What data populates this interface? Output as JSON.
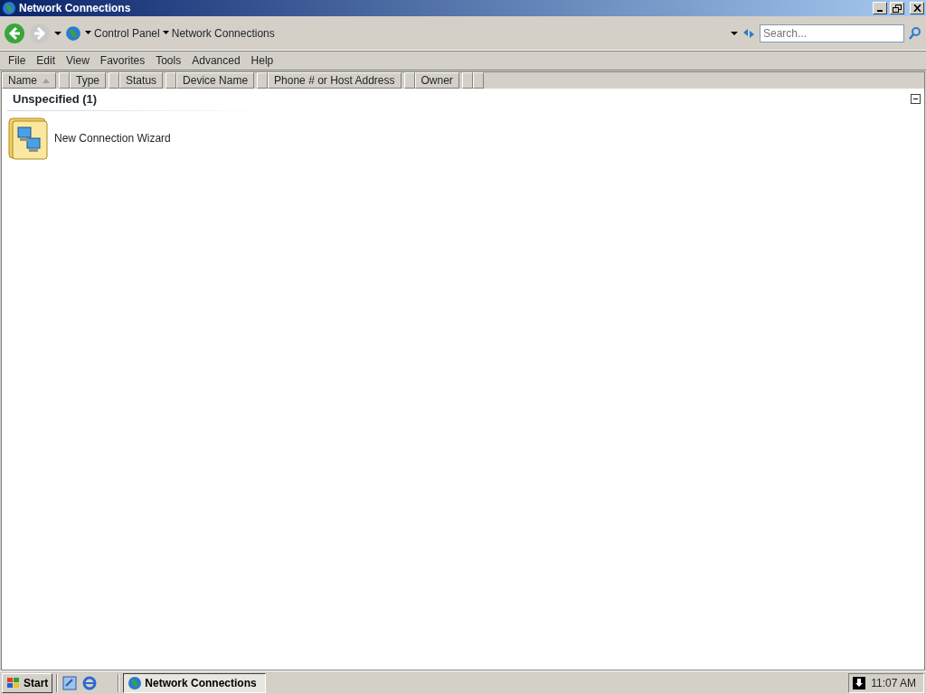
{
  "window": {
    "title": "Network Connections"
  },
  "address_bar": {
    "crumbs": [
      "Control Panel",
      "Network Connections"
    ]
  },
  "search": {
    "placeholder": "Search..."
  },
  "menu": [
    "File",
    "Edit",
    "View",
    "Favorites",
    "Tools",
    "Advanced",
    "Help"
  ],
  "columns": [
    {
      "label": "Name",
      "sorted": true
    },
    {
      "label": "Type",
      "sorted": false
    },
    {
      "label": "Status",
      "sorted": false
    },
    {
      "label": "Device Name",
      "sorted": false
    },
    {
      "label": "Phone # or Host Address",
      "sorted": false
    },
    {
      "label": "Owner",
      "sorted": false
    }
  ],
  "groups": [
    {
      "title": "Unspecified (1)",
      "expanded": true,
      "items": [
        {
          "label": "New Connection Wizard"
        }
      ]
    }
  ],
  "taskbar": {
    "start": "Start",
    "tasks": [
      {
        "label": "Network Connections",
        "selected": true
      }
    ],
    "clock": "11:07 AM"
  }
}
